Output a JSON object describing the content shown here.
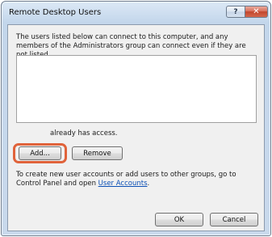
{
  "window": {
    "title": "Remote Desktop Users",
    "help_label": "?",
    "close_label": "✕"
  },
  "main": {
    "description": "The users listed below can connect to this computer, and any members of the Administrators group can connect even if they are not listed.",
    "users": [],
    "access_text": "already has access.",
    "add_label": "Add...",
    "remove_label": "Remove",
    "hint_prefix": "To create new user accounts or add users to other groups, go to Control Panel and open ",
    "hint_link": "User Accounts",
    "hint_suffix": "."
  },
  "footer": {
    "ok_label": "OK",
    "cancel_label": "Cancel"
  },
  "colors": {
    "highlight": "#e0633b",
    "link": "#0b4fb5"
  }
}
